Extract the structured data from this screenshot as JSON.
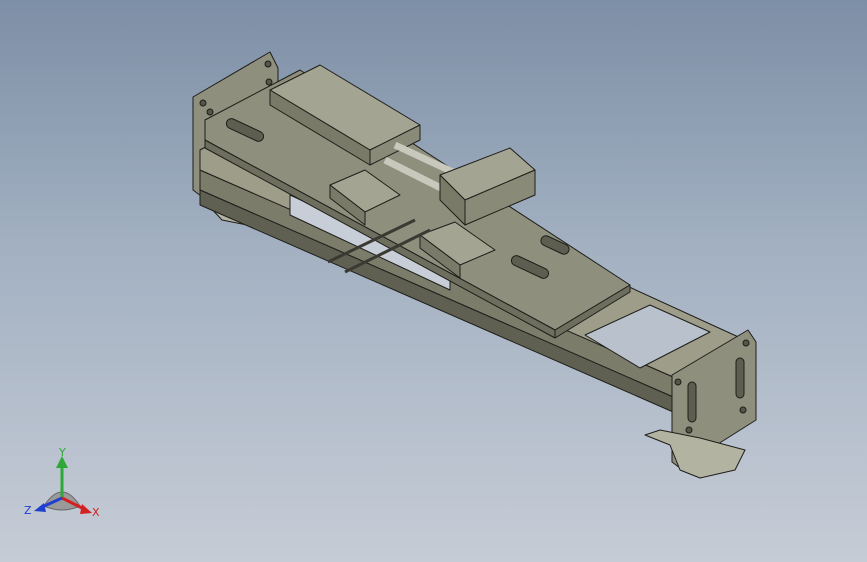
{
  "viewport": {
    "background_top": "#7d8fa6",
    "background_bottom": "#c6ccd6",
    "part_color": "#8f8f7d",
    "part_dark": "#6e6e5e",
    "part_light": "#b3b3a2",
    "edge_color": "#1e1e1a"
  },
  "triad": {
    "x_label": "X",
    "y_label": "Y",
    "z_label": "Z",
    "x_color": "#d42020",
    "y_color": "#2fa83a",
    "z_color": "#1f3fd0"
  }
}
